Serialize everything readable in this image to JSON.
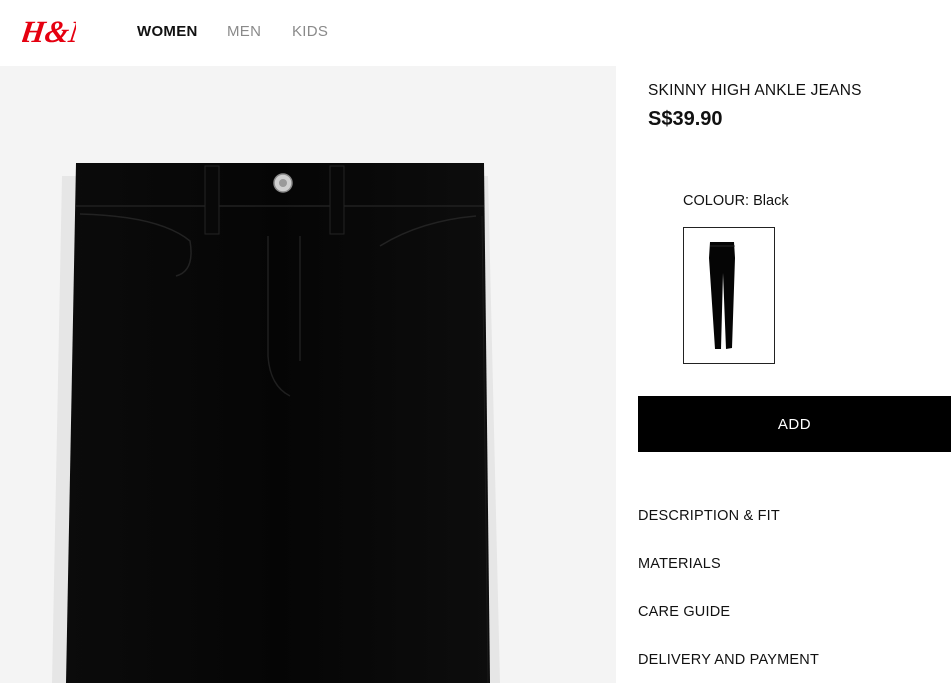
{
  "header": {
    "logo_text": "H&M",
    "nav": [
      {
        "label": "WOMEN",
        "active": true
      },
      {
        "label": "MEN",
        "active": false
      },
      {
        "label": "KIDS",
        "active": false
      }
    ]
  },
  "product": {
    "title": "SKINNY HIGH ANKLE JEANS",
    "price": "S$39.90",
    "colour_label": "COLOUR:",
    "colour_value": "Black"
  },
  "actions": {
    "add_label": "ADD"
  },
  "accordion": [
    "DESCRIPTION & FIT",
    "MATERIALS",
    "CARE GUIDE",
    "DELIVERY AND PAYMENT"
  ],
  "colors": {
    "brand_red": "#e50010",
    "button_bg": "#000000",
    "gallery_bg": "#f4f4f4"
  }
}
